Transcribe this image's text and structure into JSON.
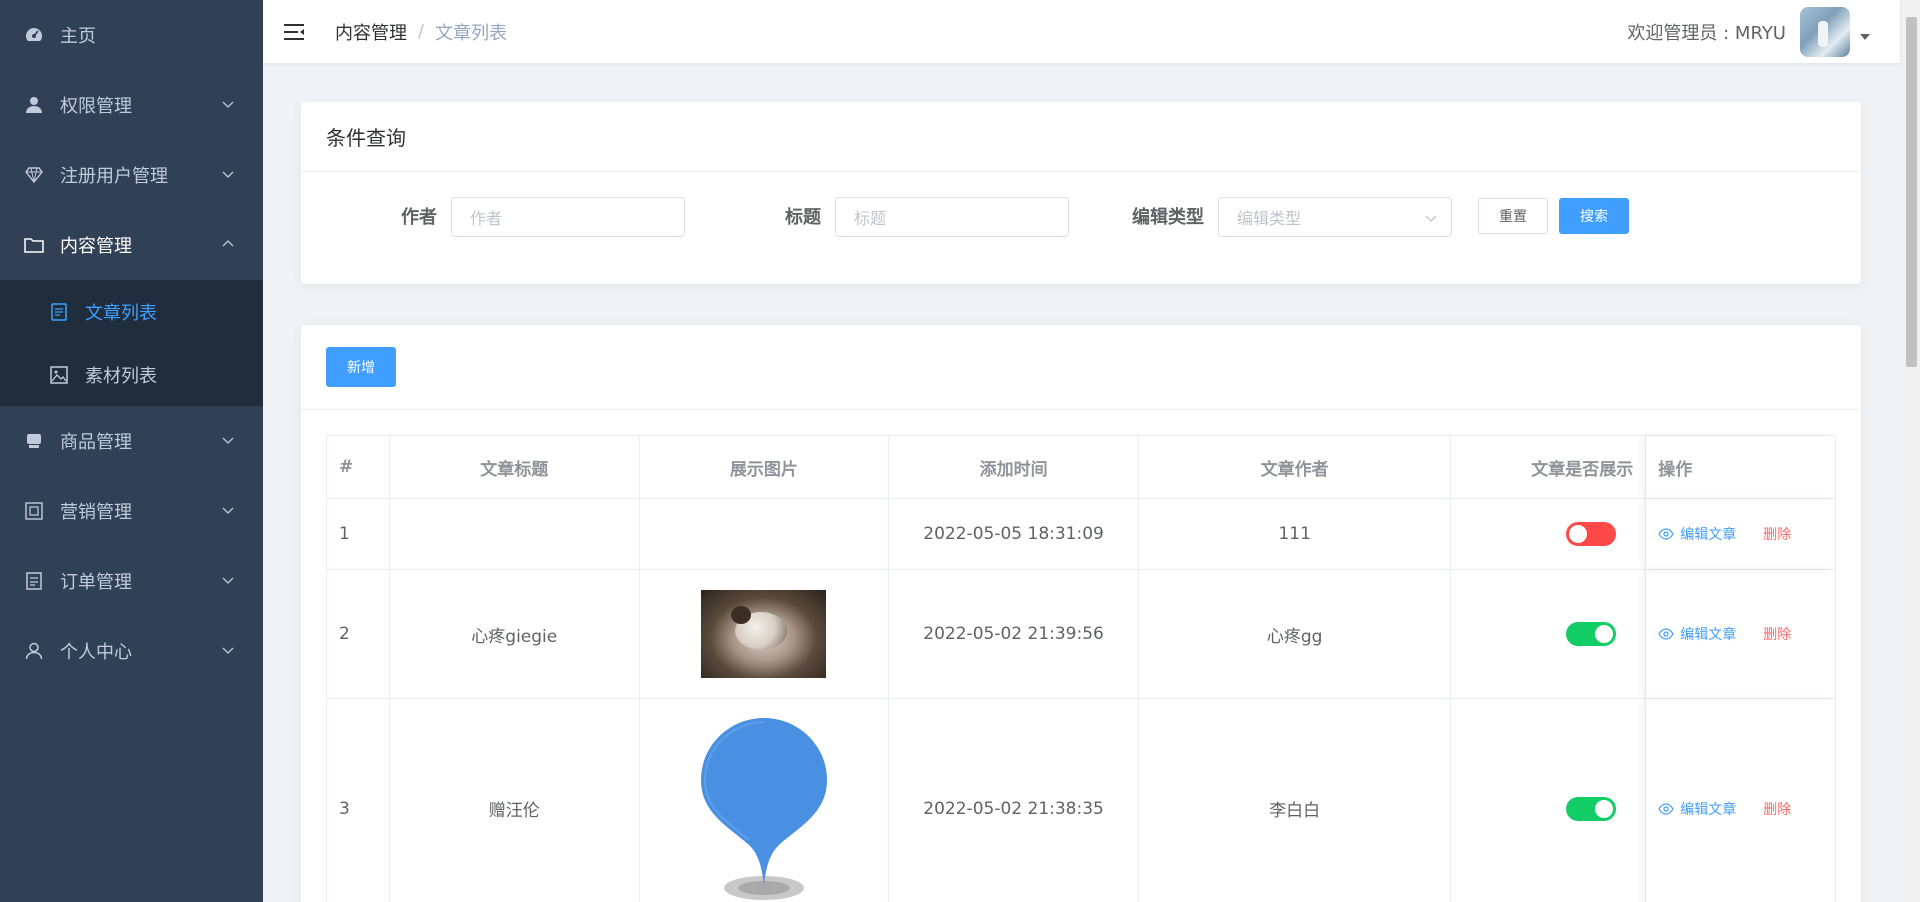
{
  "sidebar": {
    "items": [
      {
        "label": "主页",
        "icon": "dashboard-icon"
      },
      {
        "label": "权限管理",
        "icon": "user-icon"
      },
      {
        "label": "注册用户管理",
        "icon": "diamond-icon"
      },
      {
        "label": "内容管理",
        "icon": "folder-icon",
        "expanded": true
      },
      {
        "label": "商品管理",
        "icon": "shop-icon"
      },
      {
        "label": "营销管理",
        "icon": "picture-frame-icon"
      },
      {
        "label": "订单管理",
        "icon": "document-icon"
      },
      {
        "label": "个人中心",
        "icon": "person-icon"
      }
    ],
    "sub_items": [
      {
        "label": "文章列表",
        "icon": "article-icon",
        "active": true
      },
      {
        "label": "素材列表",
        "icon": "image-icon"
      }
    ],
    "bg_color": "#304156",
    "active_color": "#409eff"
  },
  "header": {
    "breadcrumb": [
      "内容管理",
      "文章列表"
    ],
    "separator": "/",
    "welcome": "欢迎管理员 : MRYU"
  },
  "query": {
    "title": "条件查询",
    "author_label": "作者",
    "author_placeholder": "作者",
    "title_label": "标题",
    "title_placeholder": "标题",
    "type_label": "编辑类型",
    "type_placeholder": "编辑类型",
    "reset_label": "重置",
    "search_label": "搜索"
  },
  "list": {
    "add_label": "新增",
    "columns": [
      "#",
      "文章标题",
      "展示图片",
      "添加时间",
      "文章作者",
      "文章是否展示",
      "操作"
    ],
    "rows": [
      {
        "index": "1",
        "title": "",
        "image": "",
        "time": "2022-05-05 18:31:09",
        "author": "111",
        "shown": false
      },
      {
        "index": "2",
        "title": "心疼giegie",
        "image": "cat-photo",
        "time": "2022-05-02 21:39:56",
        "author": "心疼gg",
        "shown": true
      },
      {
        "index": "3",
        "title": "赠汪伦",
        "image": "map-pin",
        "time": "2022-05-02 21:38:35",
        "author": "李白白",
        "shown": true
      }
    ],
    "edit_label": "编辑文章",
    "delete_label": "删除"
  }
}
